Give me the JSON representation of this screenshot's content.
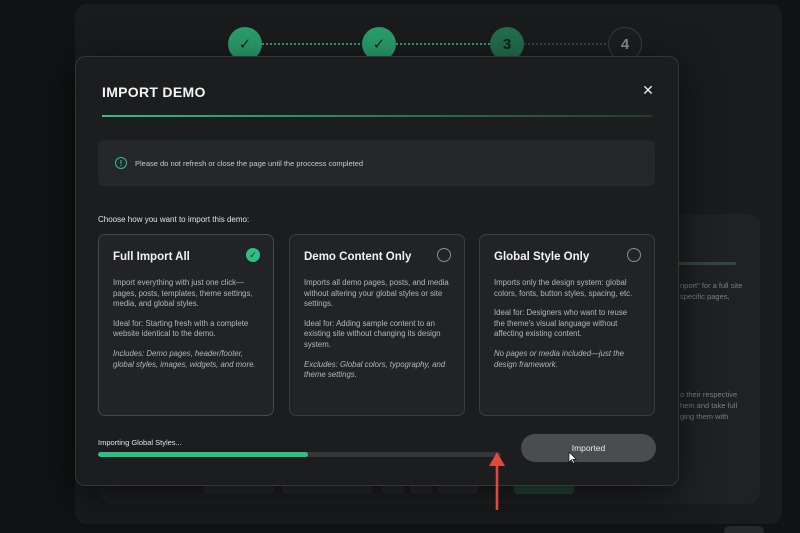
{
  "stepper": {
    "steps": [
      {
        "label": "✓",
        "state": "done"
      },
      {
        "label": "✓",
        "state": "done"
      },
      {
        "label": "3",
        "state": "active"
      },
      {
        "label": "4",
        "state": "todo"
      }
    ]
  },
  "background": {
    "lines": [
      "nport\" for a full site",
      "specific pages,",
      "o their respective",
      "hem and take full",
      "ging them with"
    ]
  },
  "modal": {
    "title": "IMPORT DEMO",
    "close_icon": "✕",
    "notice": {
      "icon": "!",
      "text": "Please do not refresh or close the page until the proccess completed"
    },
    "choose_label": "Choose how you want to import this demo:",
    "options": [
      {
        "title": "Full Import All",
        "checked": true,
        "check_glyph": "✓",
        "description": "Import everything with just one click—pages, posts, templates, theme settings, media, and global styles.",
        "ideal": "Ideal for: Starting fresh with a complete website identical to the demo.",
        "note": "Includes: Demo pages, header/footer, global styles, images, widgets, and more."
      },
      {
        "title": "Demo Content Only",
        "checked": false,
        "check_glyph": "",
        "description": "Imports all demo pages, posts, and media without altering your global styles or site settings.",
        "ideal": "Ideal for: Adding sample content to an existing site without changing its design system.",
        "note": "Excludes: Global colors, typography, and theme settings."
      },
      {
        "title": "Global Style Only",
        "checked": false,
        "check_glyph": "",
        "description": "Imports only the design system: global colors, fonts, button styles, spacing, etc.",
        "ideal": "Ideal for: Designers who want to reuse the theme's visual language without affecting existing content.",
        "note": "No pages or media included—just the design framework."
      }
    ],
    "progress": {
      "label": "Importing Global Styles...",
      "percent": 52
    },
    "imported_button": "Imported"
  },
  "colors": {
    "accent": "#2fbf82",
    "annotation_arrow": "#e0493d"
  }
}
